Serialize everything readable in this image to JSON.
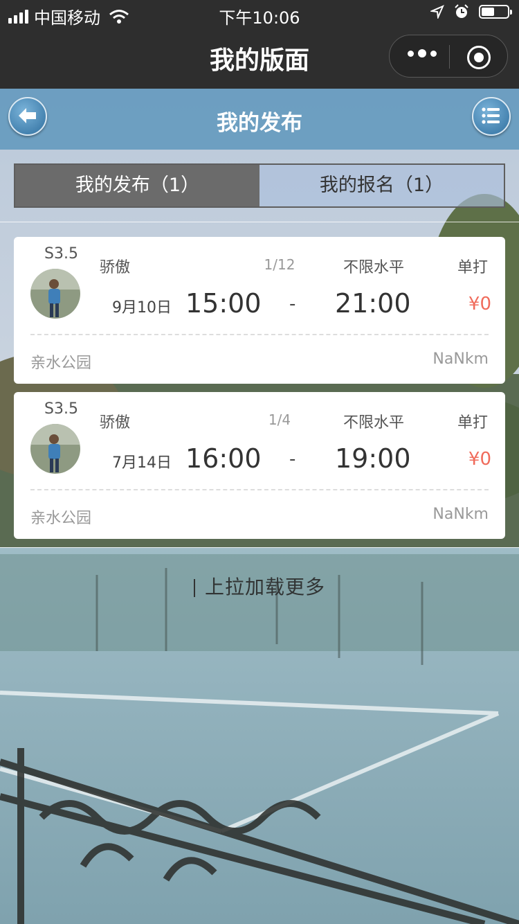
{
  "status_bar": {
    "carrier": "中国移动",
    "time": "下午10:06"
  },
  "nav_bar": {
    "title": "我的版面"
  },
  "page_header": {
    "title": "我的发布"
  },
  "tabs": [
    {
      "label": "我的发布（1）",
      "active": true
    },
    {
      "label": "我的报名（1）",
      "active": false
    }
  ],
  "posts": [
    {
      "level": "S3.5",
      "name": "骄傲",
      "count": "1/12",
      "skill": "不限水平",
      "mode": "单打",
      "date": "9月10日",
      "start": "15:00",
      "dash": "-",
      "end": "21:00",
      "price": "¥0",
      "place": "亲水公园",
      "distance": "NaNkm"
    },
    {
      "level": "S3.5",
      "name": "骄傲",
      "count": "1/4",
      "skill": "不限水平",
      "mode": "单打",
      "date": "7月14日",
      "start": "16:00",
      "dash": "-",
      "end": "19:00",
      "price": "¥0",
      "place": "亲水公园",
      "distance": "NaNkm"
    }
  ],
  "load_more": "上拉加载更多",
  "colors": {
    "bar": "#2e2e2e",
    "header": "#689cc0",
    "price": "#f06b5b"
  }
}
